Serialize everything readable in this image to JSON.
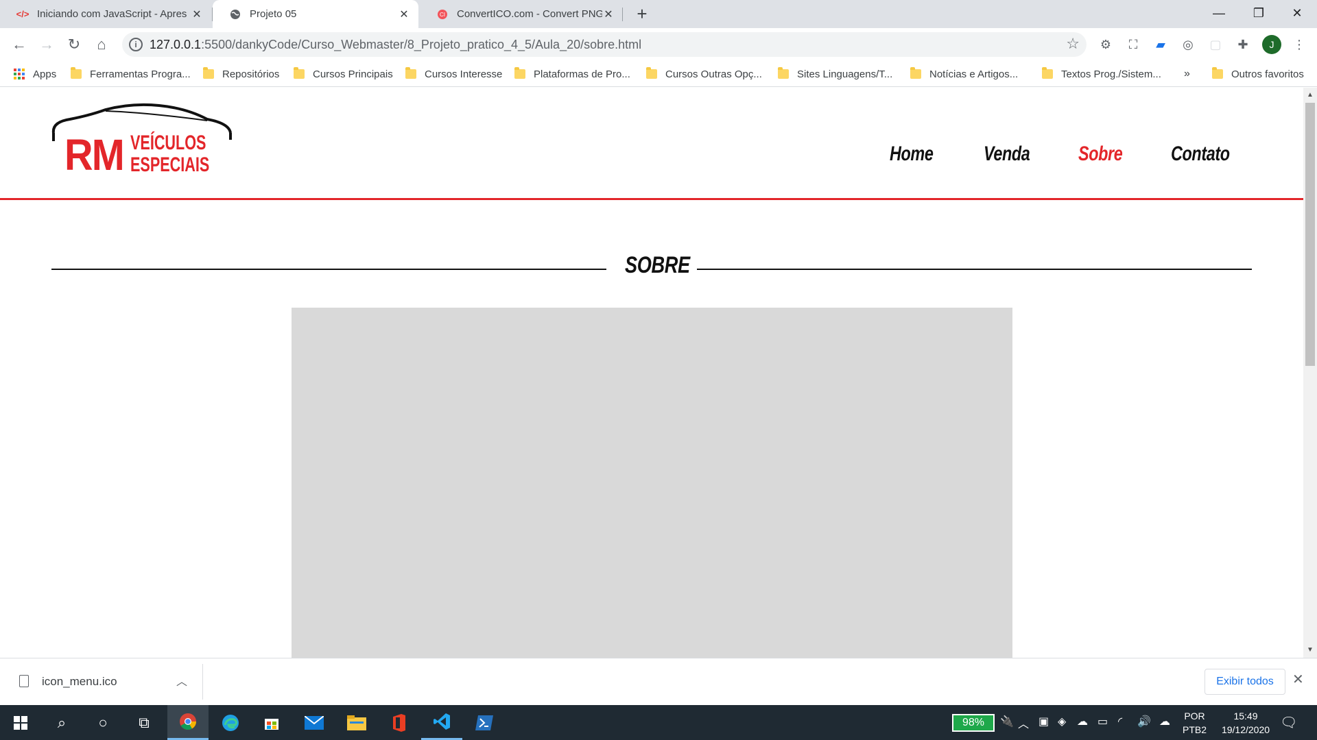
{
  "browser": {
    "tabs": [
      {
        "title": "Iniciando com JavaScript - Apres",
        "favicon": "code-icon"
      },
      {
        "title": "Projeto 05",
        "favicon": "globe-icon"
      },
      {
        "title": "ConvertICO.com - Convert PNG t",
        "favicon": "converter-icon"
      }
    ],
    "new_tab_glyph": "+",
    "url_host": "127.0.0.1",
    "url_rest": ":5500/dankyCode/Curso_Webmaster/8_Projeto_pratico_4_5/Aula_20/sobre.html",
    "profile_initial": "J",
    "bookmarks": [
      {
        "label": "Apps",
        "icon": "apps-grid-icon"
      },
      {
        "label": "Ferramentas Progra...",
        "icon": "folder-icon"
      },
      {
        "label": "Repositórios",
        "icon": "folder-icon"
      },
      {
        "label": "Cursos Principais",
        "icon": "folder-icon"
      },
      {
        "label": "Cursos Interesse",
        "icon": "folder-icon"
      },
      {
        "label": "Plataformas de Pro...",
        "icon": "folder-icon"
      },
      {
        "label": "Cursos Outras Opç...",
        "icon": "folder-icon"
      },
      {
        "label": "Sites Linguagens/T...",
        "icon": "folder-icon"
      },
      {
        "label": "Notícias e Artigos...",
        "icon": "folder-icon"
      },
      {
        "label": "Textos Prog./Sistem...",
        "icon": "folder-icon"
      }
    ],
    "bookmarks_overflow": "»",
    "other_bookmarks": "Outros favoritos"
  },
  "site": {
    "logo": {
      "line1": "RM",
      "line2a": "VEÍCULOS",
      "line2b": "ESPECIAIS"
    },
    "nav": [
      {
        "label": "Home",
        "active": false
      },
      {
        "label": "Venda",
        "active": false
      },
      {
        "label": "Sobre",
        "active": true
      },
      {
        "label": "Contato",
        "active": false
      }
    ],
    "section_title": "SOBRE",
    "accent_color": "#e3262a"
  },
  "downloads": {
    "file_name": "icon_menu.ico",
    "show_all_label": "Exibir todos"
  },
  "taskbar": {
    "battery": "98%",
    "lang_line1": "POR",
    "lang_line2": "PTB2",
    "time": "15:49",
    "date": "19/12/2020"
  }
}
